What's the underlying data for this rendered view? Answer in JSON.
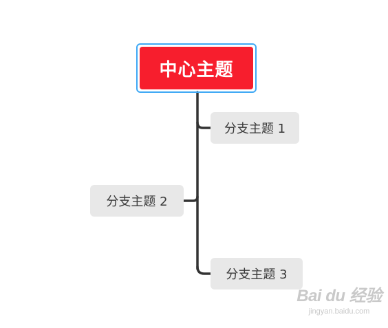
{
  "mindmap": {
    "central_topic": "中心主题",
    "branches": [
      {
        "label": "分支主题 1"
      },
      {
        "label": "分支主题 2"
      },
      {
        "label": "分支主题 3"
      }
    ]
  },
  "watermark": {
    "logo_text": "Bai du 经验",
    "url": "jingyan.baidu.com"
  },
  "colors": {
    "central_fill": "#f71e2d",
    "selection_border": "#3ea8f5",
    "branch_fill": "#e8e8e8",
    "connector": "#333333",
    "branch_text": "#3a3a3a"
  }
}
